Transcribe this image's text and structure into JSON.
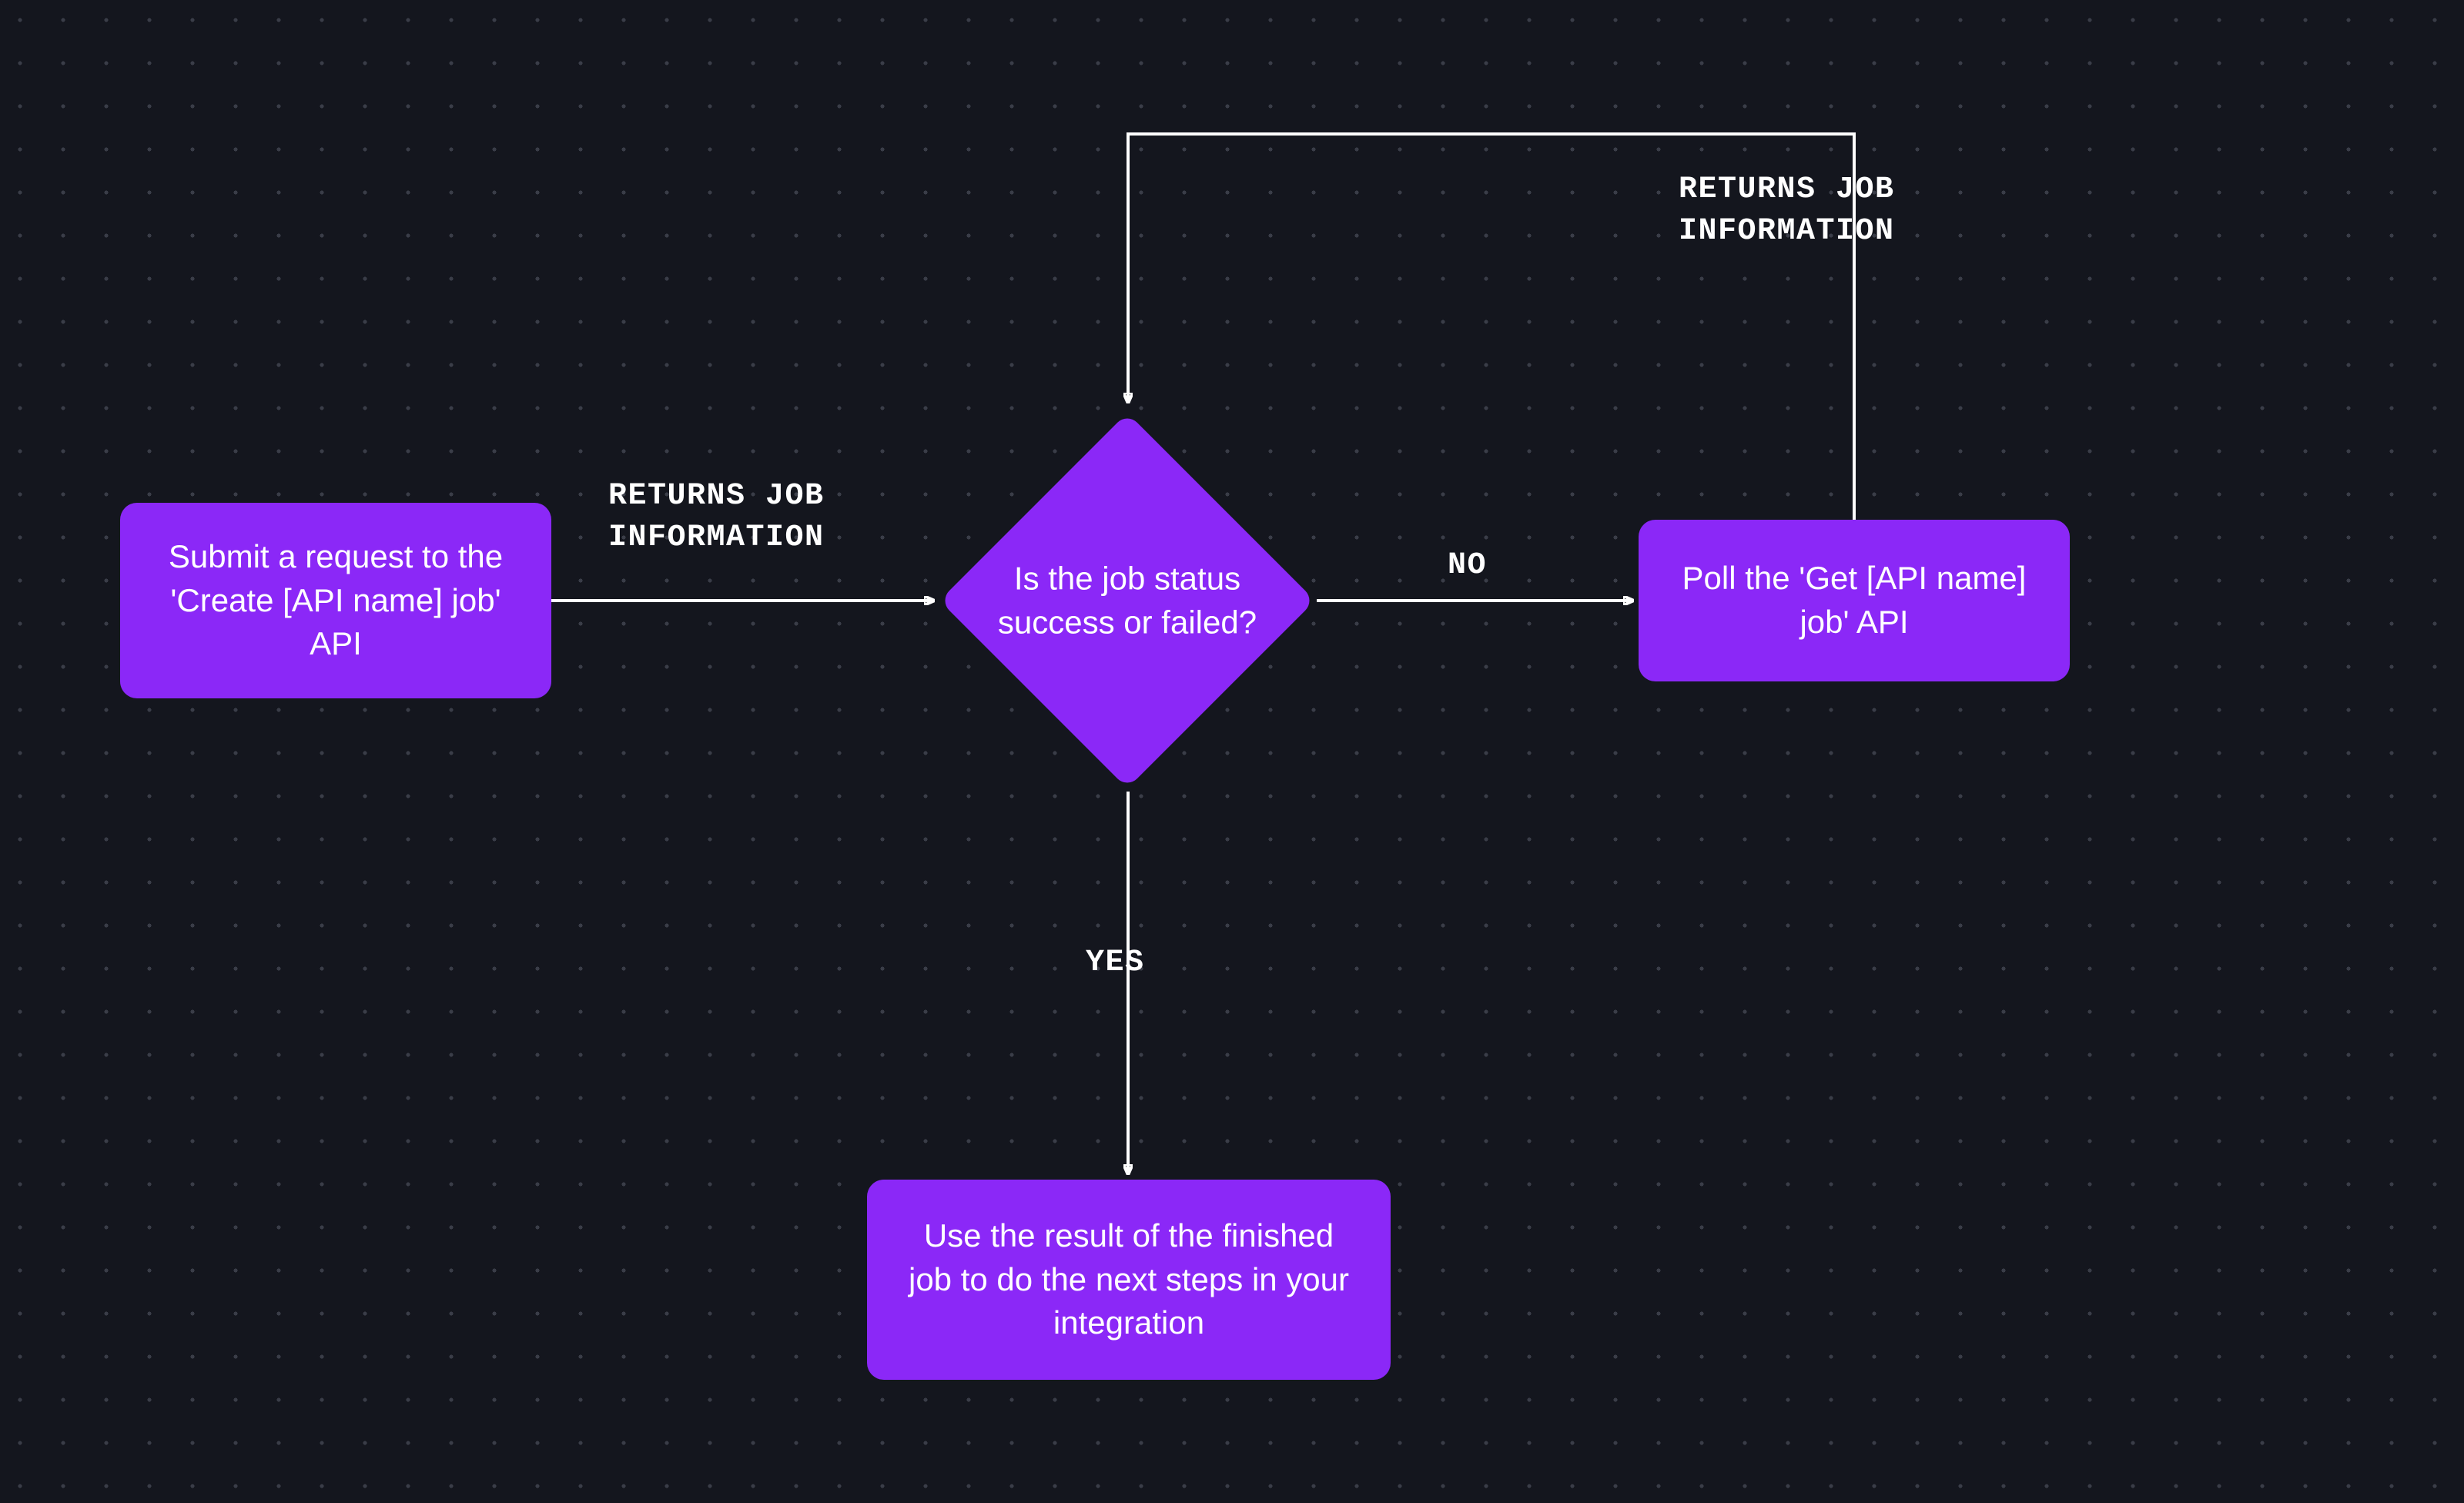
{
  "nodes": {
    "start": {
      "label": "Submit a request to the 'Create [API name] job' API"
    },
    "decision": {
      "label": "Is the job status success or failed?"
    },
    "poll": {
      "label": "Poll the 'Get [API name] job' API"
    },
    "result": {
      "label": "Use the result of the finished job to do the next steps in your integration"
    }
  },
  "edges": {
    "start_to_decision": {
      "label": "RETURNS JOB\nINFORMATION"
    },
    "decision_to_poll": {
      "label": "NO"
    },
    "decision_to_result": {
      "label": "YES"
    },
    "poll_to_decision": {
      "label": "RETURNS JOB\nINFORMATION"
    }
  },
  "colors": {
    "background": "#14161e",
    "node_fill": "#8b28f7",
    "text": "#ffffff",
    "connector": "#ffffff",
    "dot": "#3a3d48"
  }
}
